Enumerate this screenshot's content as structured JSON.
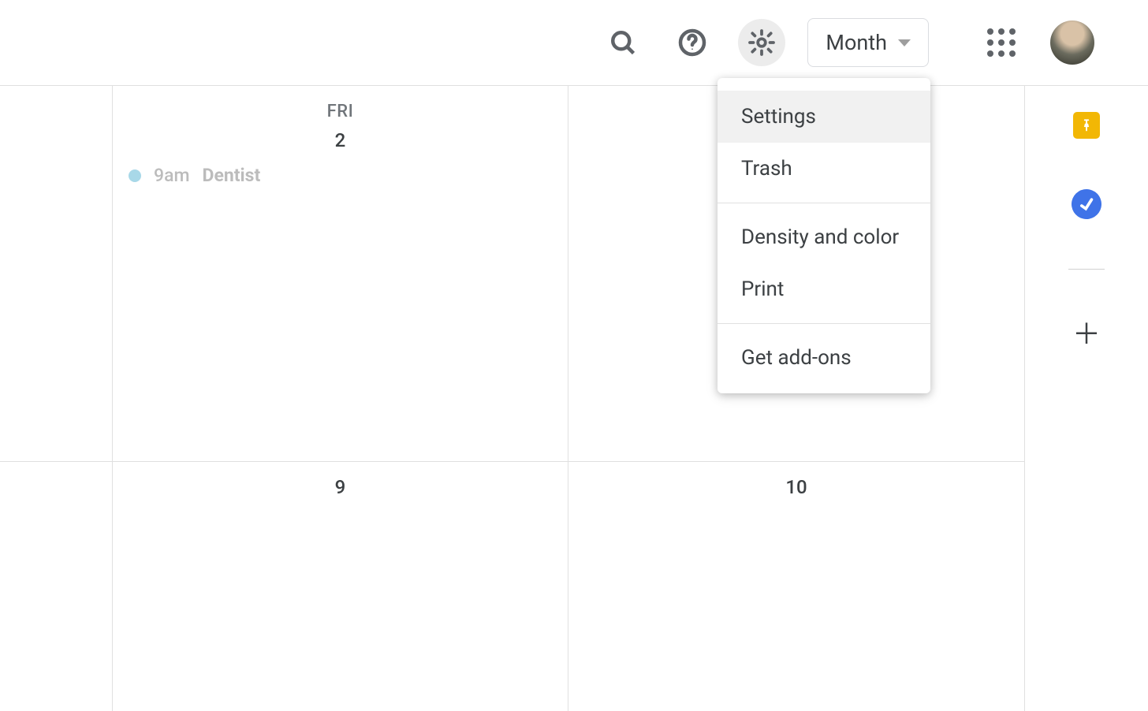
{
  "header": {
    "view_label": "Month"
  },
  "menu": {
    "items": [
      {
        "label": "Settings",
        "hovered": true
      },
      {
        "label": "Trash"
      }
    ],
    "items2": [
      {
        "label": "Density and color"
      },
      {
        "label": "Print"
      }
    ],
    "items3": [
      {
        "label": "Get add-ons"
      }
    ]
  },
  "calendar": {
    "row1": {
      "cell1": {
        "dayname": "FRI",
        "daynum": "2",
        "event": {
          "time": "9am",
          "title": "Dentist"
        }
      },
      "cell2": {
        "daynum": ""
      }
    },
    "row2": {
      "cell1": {
        "daynum": "9"
      },
      "cell2": {
        "daynum": "10"
      }
    }
  }
}
